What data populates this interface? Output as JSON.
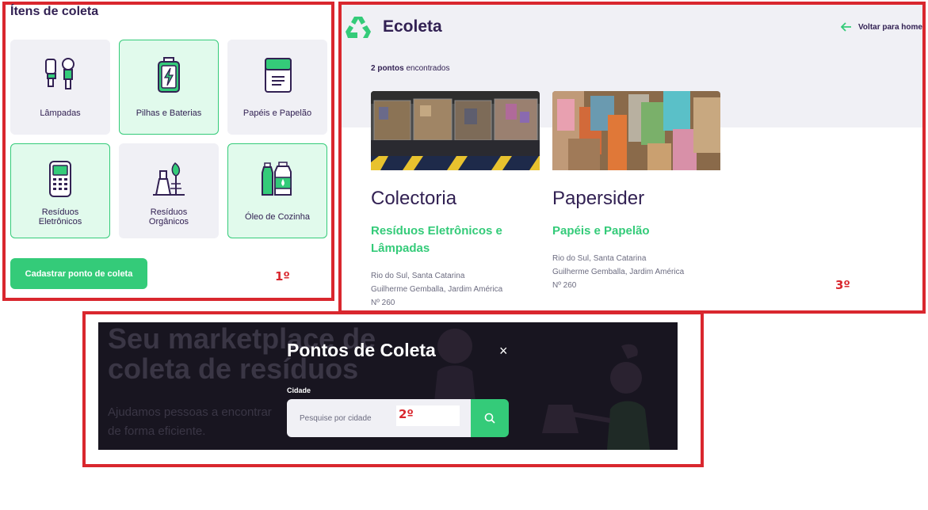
{
  "panel1": {
    "title": "Ítens de coleta",
    "items": [
      {
        "label": "Lâmpadas",
        "icon": "lamps-icon",
        "selected": false
      },
      {
        "label": "Pilhas e Baterias",
        "icon": "battery-icon",
        "selected": true
      },
      {
        "label": "Papéis e Papelão",
        "icon": "paper-icon",
        "selected": false
      },
      {
        "label": "Resíduos\nEletrônicos",
        "icon": "electronics-icon",
        "selected": true
      },
      {
        "label": "Resíduos\nOrgânicos",
        "icon": "organic-icon",
        "selected": false
      },
      {
        "label": "Óleo de Cozinha",
        "icon": "oil-icon",
        "selected": true
      }
    ],
    "button_label": "Cadastrar ponto de coleta",
    "marker": "1º"
  },
  "panel2": {
    "bg_heading": "Seu marketplace de\ncoleta de resíduos",
    "bg_text": "Ajudamos pessoas a encontrar\nde forma eficiente.",
    "modal_title": "Pontos de Coleta",
    "close_symbol": "×",
    "field_label": "Cidade",
    "search_placeholder": "Pesquise por cidade",
    "marker": "2º"
  },
  "panel3": {
    "logo": "Ecoleta",
    "back_label": "Voltar para home",
    "count_bold": "2 pontos",
    "count_rest": " encontrados",
    "cards": [
      {
        "name": "Colectoria",
        "items": "Resíduos Eletrônicos e\nLâmpadas",
        "address": "Rio do Sul, Santa Catarina\nGuilherme Gemballa, Jardim América\nNº 260"
      },
      {
        "name": "Papersider",
        "items": "Papéis e Papelão",
        "address": "Rio do Sul, Santa Catarina\nGuilherme Gemballa, Jardim América\nNº 260"
      }
    ],
    "marker": "3º"
  },
  "colors": {
    "accent": "#34cb79",
    "title": "#322153",
    "text": "#6c6c80",
    "frame": "#d9272e",
    "bg": "#f0f0f5"
  }
}
